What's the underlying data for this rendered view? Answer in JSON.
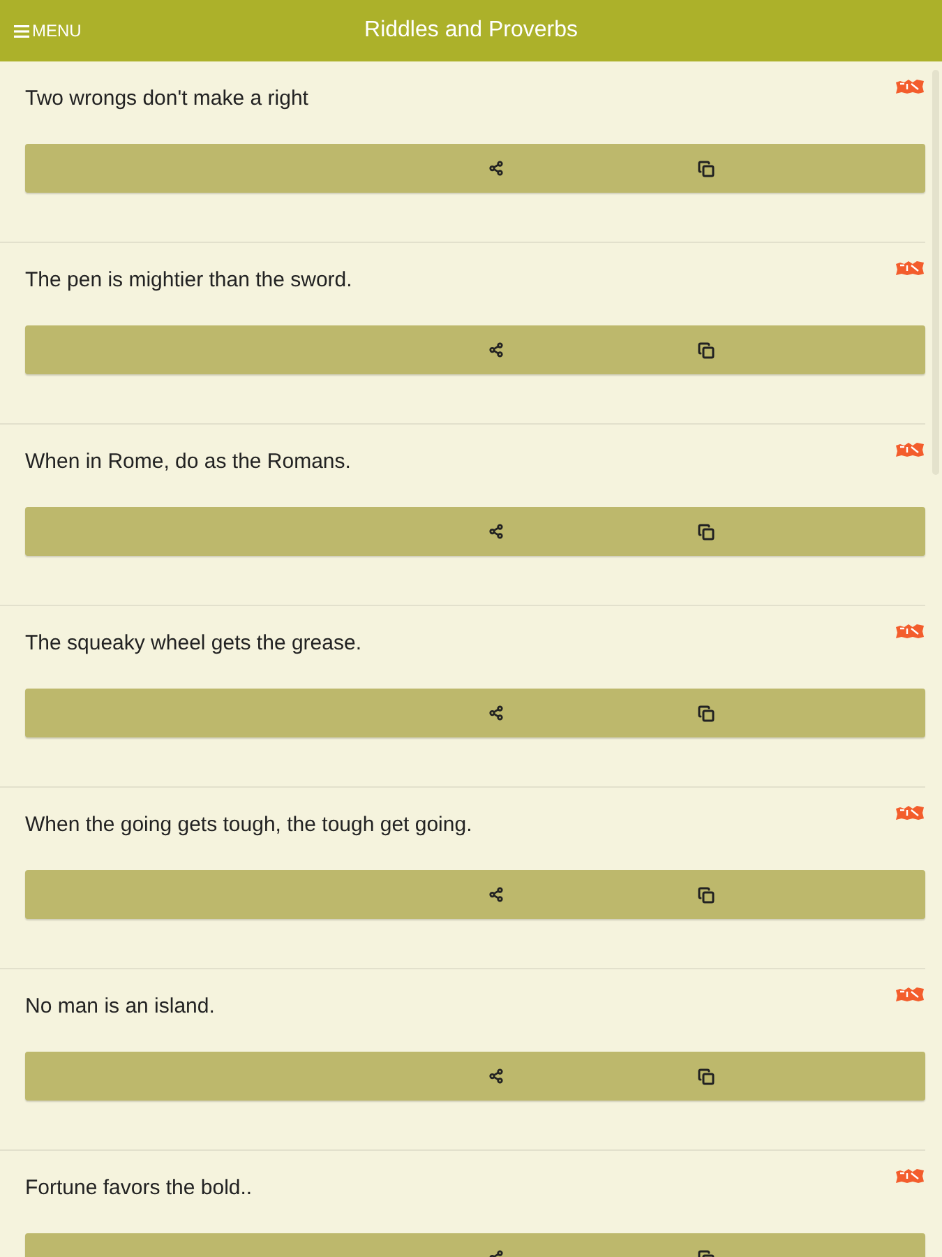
{
  "header": {
    "menu_label": "MENU",
    "title": "Riddles and Proverbs"
  },
  "proverbs": [
    {
      "text": "Two wrongs don't make a right",
      "new": true
    },
    {
      "text": "The pen is mightier than the sword.",
      "new": true
    },
    {
      "text": "When in Rome, do as the Romans.",
      "new": true
    },
    {
      "text": "The squeaky wheel gets the grease.",
      "new": true
    },
    {
      "text": "When the going gets tough, the tough get going.",
      "new": true
    },
    {
      "text": "No man is an island.",
      "new": true
    },
    {
      "text": "Fortune favors the bold..",
      "new": true
    }
  ]
}
